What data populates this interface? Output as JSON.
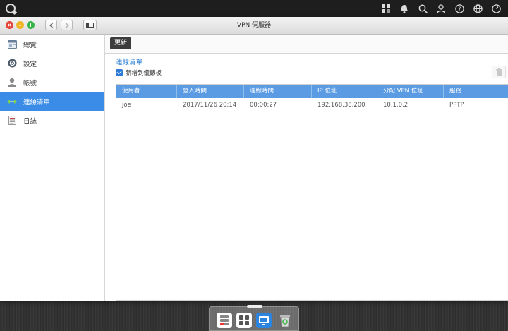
{
  "window": {
    "title": "VPN 伺服器"
  },
  "sidebar": {
    "items": [
      {
        "label": "總覽",
        "icon": "overview-icon",
        "active": false
      },
      {
        "label": "設定",
        "icon": "settings-icon",
        "active": false
      },
      {
        "label": "帳號",
        "icon": "account-icon",
        "active": false
      },
      {
        "label": "連線清單",
        "icon": "connection-list-icon",
        "active": true
      },
      {
        "label": "日誌",
        "icon": "log-icon",
        "active": false
      }
    ]
  },
  "toolbar": {
    "update_label": "更新"
  },
  "main": {
    "section_title": "連線清單",
    "checkbox_label": "新增到儀錶板",
    "checkbox_checked": true
  },
  "table": {
    "headers": [
      "使用者",
      "登入時間",
      "連線時間",
      "IP 位址",
      "分配 VPN 位址",
      "服務"
    ],
    "rows": [
      [
        "joe",
        "2017/11/26 20:14",
        "00:00:27",
        "192.168.38.200",
        "10.1.0.2",
        "PPTP"
      ]
    ]
  },
  "colors": {
    "accent": "#3a8ce7",
    "table_header": "#5b9be3",
    "link": "#2a7fd4"
  }
}
